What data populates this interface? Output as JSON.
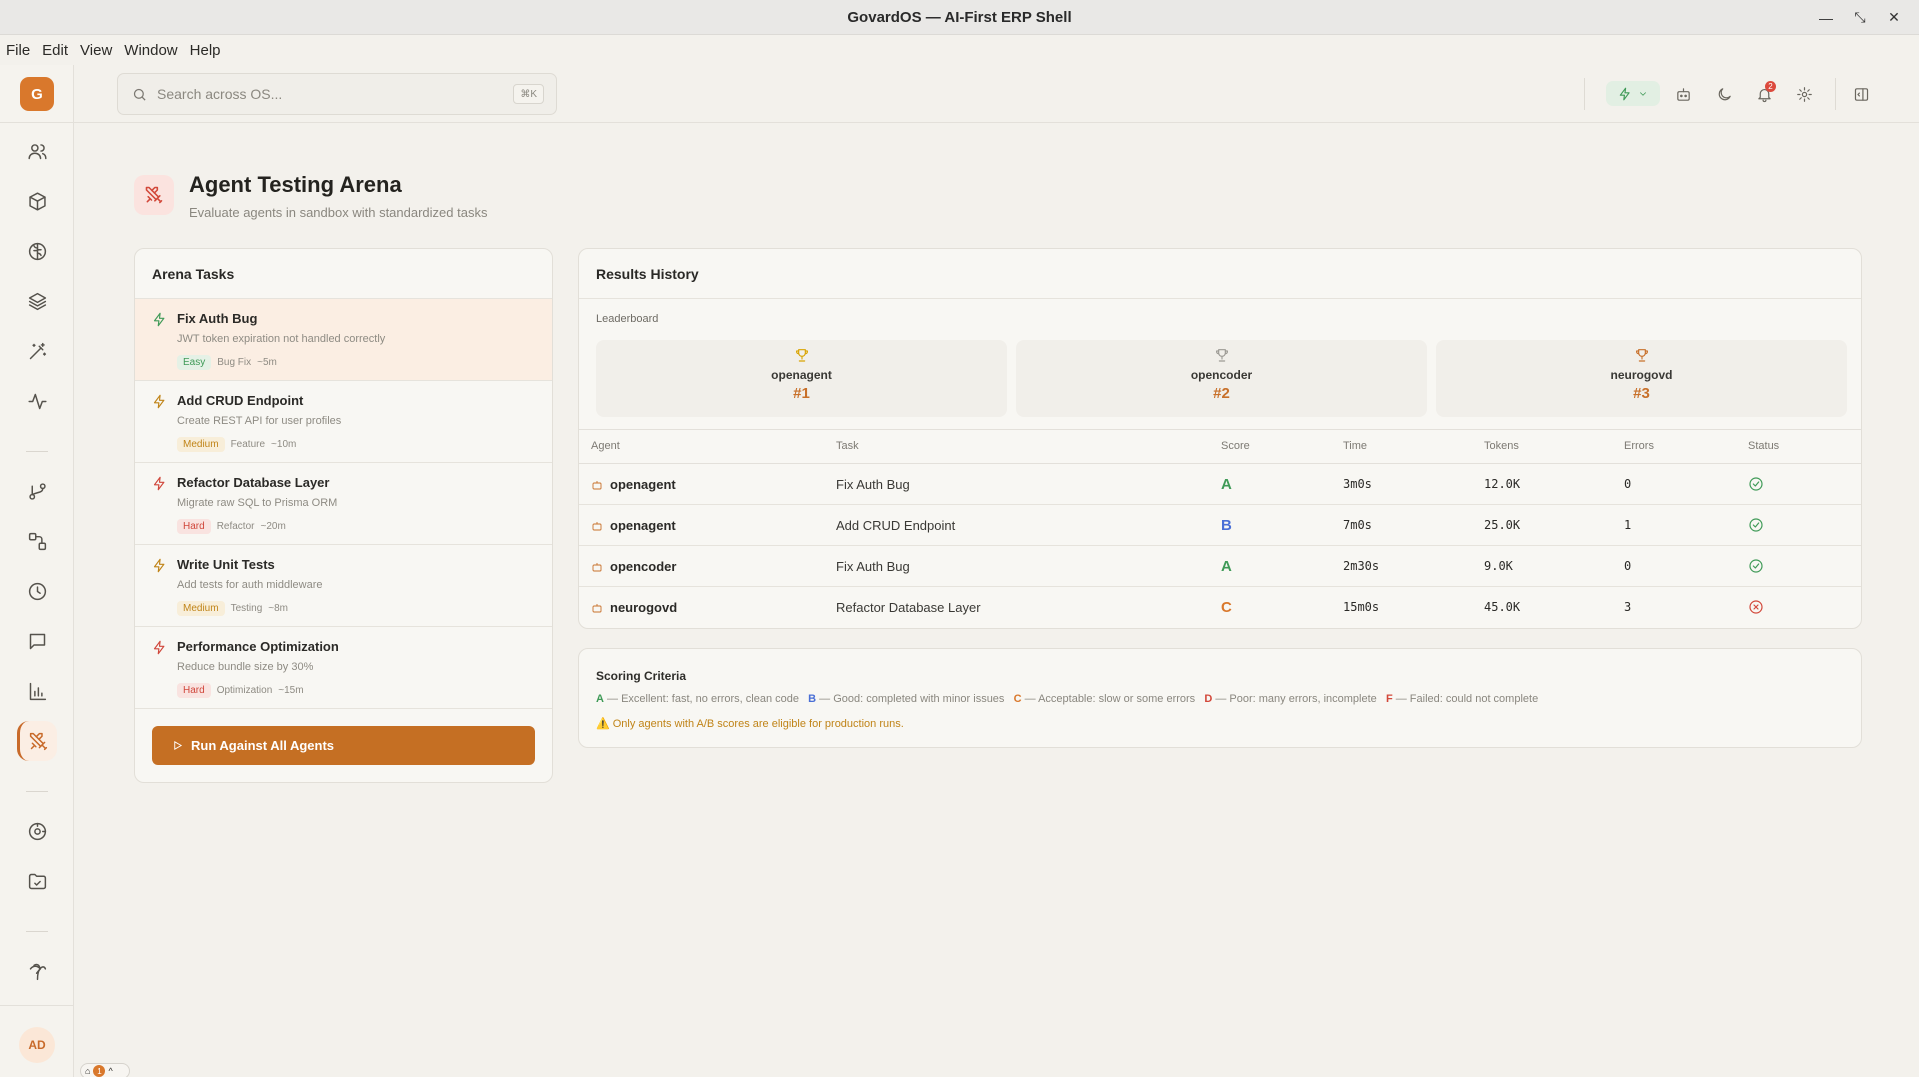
{
  "window": {
    "title": "GovardOS — AI-First ERP Shell"
  },
  "menu": [
    "File",
    "Edit",
    "View",
    "Window",
    "Help"
  ],
  "sidebar": {
    "logo": "G",
    "user_initials": "AD",
    "mini_badge_count": "1"
  },
  "search": {
    "placeholder": "Search across OS...",
    "shortcut": "⌘K"
  },
  "topbar": {
    "notification_count": "2"
  },
  "page": {
    "title": "Agent Testing Arena",
    "subtitle": "Evaluate agents in sandbox with standardized tasks"
  },
  "tasks_panel": {
    "title": "Arena Tasks",
    "tasks": [
      {
        "name": "Fix Auth Bug",
        "desc": "JWT token expiration not handled correctly",
        "difficulty": "Easy",
        "category": "Bug Fix",
        "eta": "~5m"
      },
      {
        "name": "Add CRUD Endpoint",
        "desc": "Create REST API for user profiles",
        "difficulty": "Medium",
        "category": "Feature",
        "eta": "~10m"
      },
      {
        "name": "Refactor Database Layer",
        "desc": "Migrate raw SQL to Prisma ORM",
        "difficulty": "Hard",
        "category": "Refactor",
        "eta": "~20m"
      },
      {
        "name": "Write Unit Tests",
        "desc": "Add tests for auth middleware",
        "difficulty": "Medium",
        "category": "Testing",
        "eta": "~8m"
      },
      {
        "name": "Performance Optimization",
        "desc": "Reduce bundle size by 30%",
        "difficulty": "Hard",
        "category": "Optimization",
        "eta": "~15m"
      }
    ],
    "run_button": "Run Against All Agents"
  },
  "results": {
    "title": "Results History",
    "leaderboard_label": "Leaderboard",
    "leaderboard": [
      {
        "name": "openagent",
        "rank": "#1"
      },
      {
        "name": "opencoder",
        "rank": "#2"
      },
      {
        "name": "neurogovd",
        "rank": "#3"
      }
    ],
    "columns": [
      "Agent",
      "Task",
      "Score",
      "Time",
      "Tokens",
      "Errors",
      "Status"
    ],
    "rows": [
      {
        "agent": "openagent",
        "task": "Fix Auth Bug",
        "score": "A",
        "time": "3m0s",
        "tokens": "12.0K",
        "errors": "0",
        "status": "success"
      },
      {
        "agent": "openagent",
        "task": "Add CRUD Endpoint",
        "score": "B",
        "time": "7m0s",
        "tokens": "25.0K",
        "errors": "1",
        "status": "success"
      },
      {
        "agent": "opencoder",
        "task": "Fix Auth Bug",
        "score": "A",
        "time": "2m30s",
        "tokens": "9.0K",
        "errors": "0",
        "status": "success"
      },
      {
        "agent": "neurogovd",
        "task": "Refactor Database Layer",
        "score": "C",
        "time": "15m0s",
        "tokens": "45.0K",
        "errors": "3",
        "status": "failed"
      }
    ]
  },
  "criteria": {
    "title": "Scoring Criteria",
    "items": [
      {
        "grade": "A",
        "text": " — Excellent: fast, no errors, clean code"
      },
      {
        "grade": "B",
        "text": " — Good: completed with minor issues"
      },
      {
        "grade": "C",
        "text": " — Acceptable: slow or some errors"
      },
      {
        "grade": "D",
        "text": " — Poor: many errors, incomplete"
      },
      {
        "grade": "F",
        "text": " — Failed: could not complete"
      }
    ],
    "warning": "⚠️ Only agents with A/B scores are eligible for production runs."
  },
  "colors": {
    "accent": "#c56f23",
    "grade_A": "#3f9a57",
    "grade_B": "#4a6fd6",
    "grade_C": "#d9782c",
    "grade_D": "#d2483a",
    "grade_F": "#d2483a",
    "success": "#3f9a57",
    "failed": "#d2483a"
  }
}
